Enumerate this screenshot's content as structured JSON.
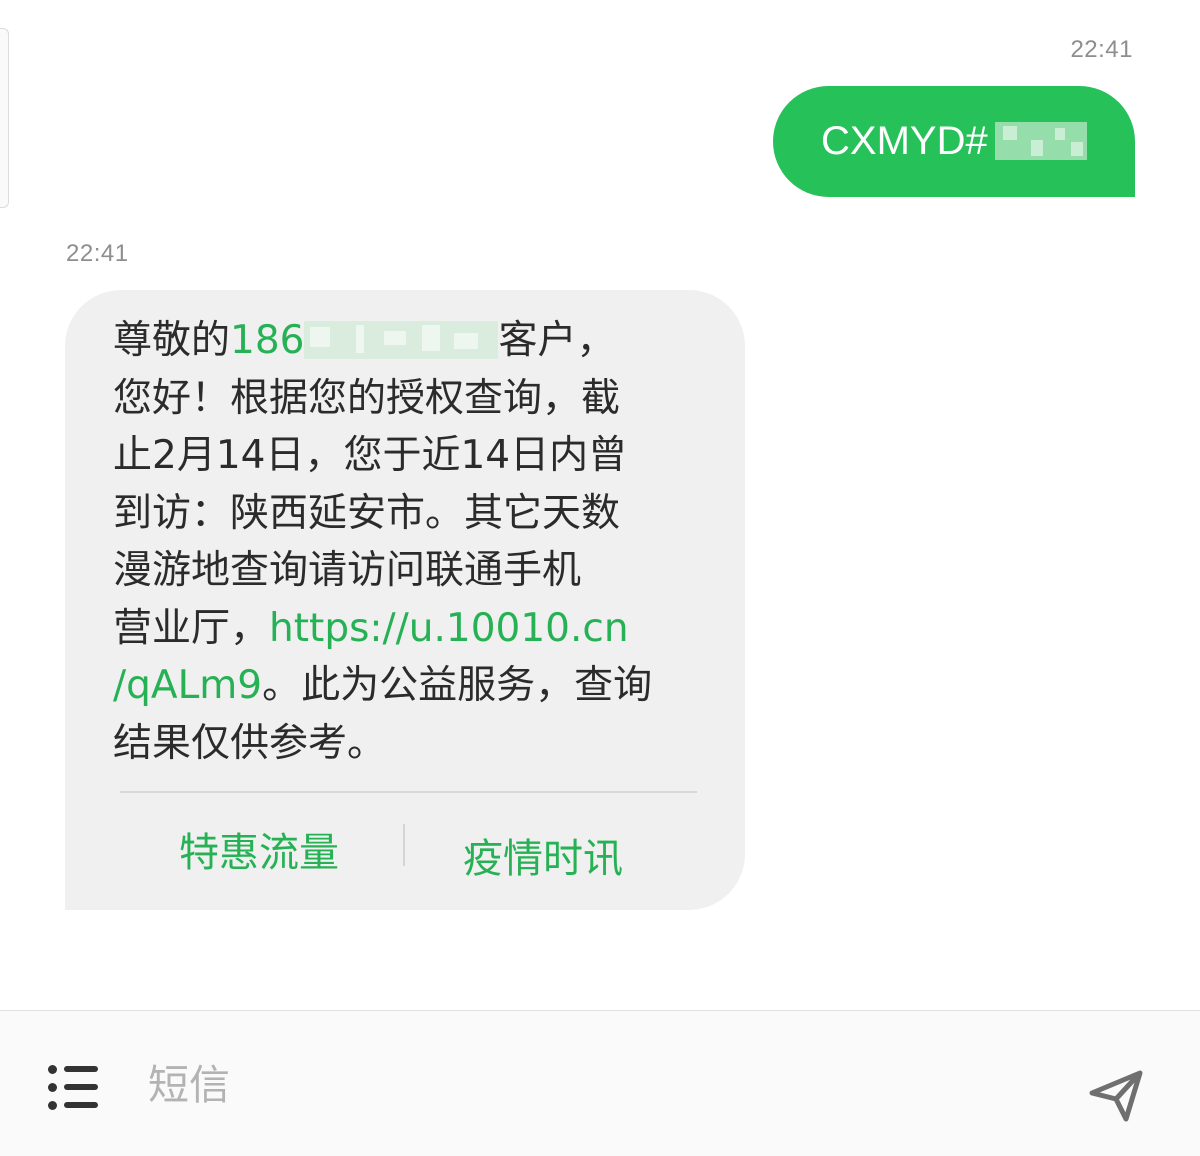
{
  "sent": {
    "timestamp": "22:41",
    "text_visible": "CXMYD#"
  },
  "received": {
    "timestamp": "22:41",
    "greeting_prefix": "尊敬的",
    "phone_visible": "186",
    "greeting_suffix": "客户，",
    "line2": "您好！根据您的授权查询，截",
    "line3": "止2月14日，您于近14日内曾",
    "line4": "到访：陕西延安市。其它天数",
    "line5": "漫游地查询请访问联通手机",
    "line6_prefix": "营业厅，",
    "link_part1": "https://u.10010.cn",
    "link_part2": "/qALm9",
    "line7_suffix": "。此为公益服务，查询",
    "line8": "结果仅供参考。",
    "actions": [
      {
        "label": "特惠流量"
      },
      {
        "label": "疫情时讯"
      }
    ]
  },
  "composer": {
    "placeholder": "短信"
  },
  "colors": {
    "accent_green": "#27c15a",
    "link_green": "#27b155",
    "received_bubble": "#f0f0f0",
    "timestamp_gray": "#8e8e8e"
  },
  "icons": {
    "menu": "list-menu-icon",
    "send": "paper-plane-send-icon"
  }
}
